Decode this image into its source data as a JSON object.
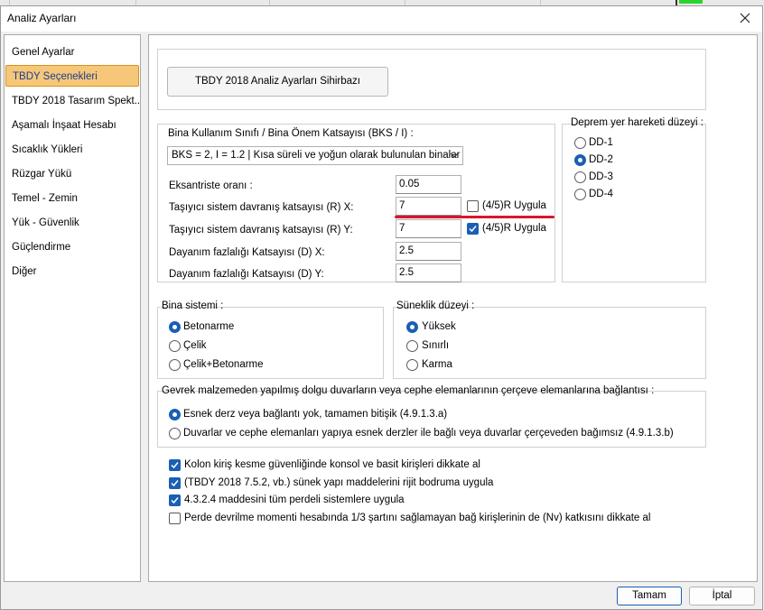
{
  "window": {
    "title": "Analiz Ayarları"
  },
  "sidebar": {
    "items": [
      {
        "label": "Genel Ayarlar",
        "selected": false
      },
      {
        "label": "TBDY Seçenekleri",
        "selected": true
      },
      {
        "label": "TBDY 2018 Tasarım Spekt...",
        "selected": false
      },
      {
        "label": "Aşamalı İnşaat Hesabı",
        "selected": false
      },
      {
        "label": "Sıcaklık Yükleri",
        "selected": false
      },
      {
        "label": "Rüzgar Yükü",
        "selected": false
      },
      {
        "label": "Temel - Zemin",
        "selected": false
      },
      {
        "label": "Yük - Güvenlik",
        "selected": false
      },
      {
        "label": "Güçlendirme",
        "selected": false
      },
      {
        "label": "Diğer",
        "selected": false
      }
    ]
  },
  "wizard": {
    "label": "TBDY 2018 Analiz Ayarları Sihirbazı"
  },
  "building": {
    "group_label": "Bina Kullanım Sınıfı / Bina Önem Katsayısı (BKS / I) :",
    "selected": "BKS = 2, I = 1.2 | Kısa süreli ve yoğun olarak bulunulan binalar",
    "fields": [
      {
        "label": "Eksantriste oranı :",
        "value": "0.05"
      },
      {
        "label": "Taşıyıcı sistem davranış katsayısı (R) X:",
        "value": "7"
      },
      {
        "label": "Taşıyıcı sistem davranış katsayısı (R) Y:",
        "value": "7"
      },
      {
        "label": "Dayanım fazlalığı Katsayısı (D) X:",
        "value": "2.5"
      },
      {
        "label": "Dayanım fazlalığı Katsayısı (D) Y:",
        "value": "2.5"
      }
    ],
    "r_x_apply": {
      "label": "(4/5)R Uygula",
      "checked": false
    },
    "r_y_apply": {
      "label": "(4/5)R Uygula",
      "checked": true
    }
  },
  "earthquake": {
    "group_label": "Deprem yer hareketi düzeyi :",
    "options": [
      {
        "label": "DD-1",
        "checked": false
      },
      {
        "label": "DD-2",
        "checked": true
      },
      {
        "label": "DD-3",
        "checked": false
      },
      {
        "label": "DD-4",
        "checked": false
      }
    ]
  },
  "system": {
    "group_label": "Bina sistemi :",
    "options": [
      {
        "label": "Betonarme",
        "checked": true
      },
      {
        "label": "Çelik",
        "checked": false
      },
      {
        "label": "Çelik+Betonarme",
        "checked": false
      }
    ]
  },
  "ductility": {
    "group_label": "Süneklik düzeyi :",
    "options": [
      {
        "label": "Yüksek",
        "checked": true
      },
      {
        "label": "Sınırlı",
        "checked": false
      },
      {
        "label": "Karma",
        "checked": false
      }
    ]
  },
  "infill": {
    "group_label": "Gevrek malzemeden yapılmış dolgu duvarların veya cephe elemanlarının çerçeve elemanlarına bağlantısı :",
    "options": [
      {
        "label": "Esnek derz veya bağlantı yok, tamamen bitişik (4.9.1.3.a)",
        "checked": true
      },
      {
        "label": "Duvarlar ve cephe elemanları yapıya esnek derzler ile bağlı veya duvarlar çerçeveden bağımsız (4.9.1.3.b)",
        "checked": false
      }
    ]
  },
  "checks": [
    {
      "label": "Kolon kiriş kesme güvenliğinde konsol ve basit kirişleri dikkate al",
      "checked": true
    },
    {
      "label": "(TBDY 2018 7.5.2, vb.) sünek yapı maddelerini rijit bodruma uygula",
      "checked": true
    },
    {
      "label": "4.3.2.4 maddesini tüm perdeli sistemlere uygula",
      "checked": true
    },
    {
      "label": "Perde devrilme momenti hesabında 1/3 şartını sağlamayan bağ kirişlerinin de (Nv) katkısını dikkate al",
      "checked": false
    }
  ],
  "buttons": {
    "ok": "Tamam",
    "cancel": "İptal"
  },
  "colors": {
    "accent": "#1a5fb4",
    "selected_bg": "#f6c779",
    "highlight": "#d9162f"
  }
}
